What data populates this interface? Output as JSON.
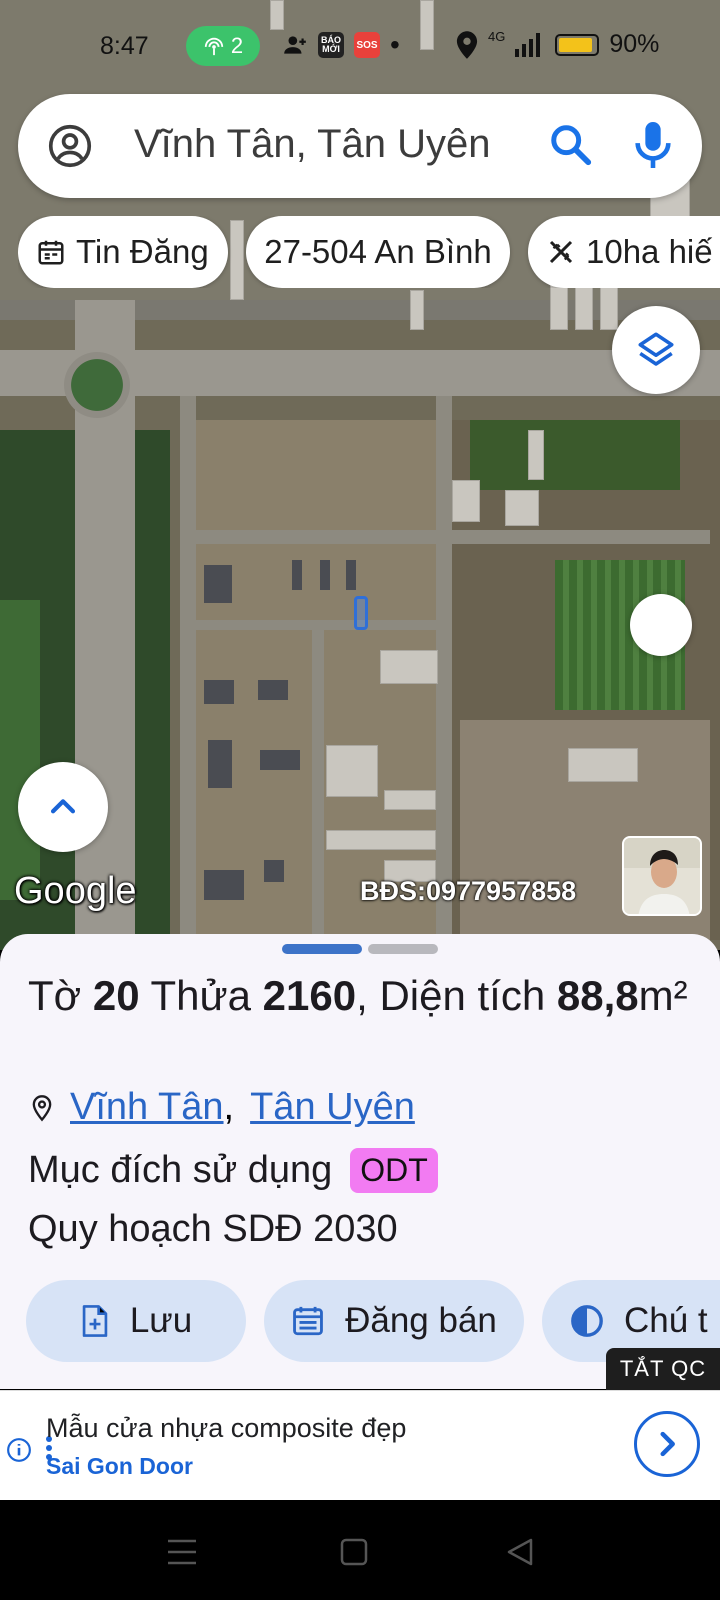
{
  "status_bar": {
    "time": "8:47",
    "hotspot_count": "2",
    "app_badge": "BÁO MỚI",
    "sos_badge": "SOS",
    "network": "4G",
    "battery_percent": "90%",
    "battery_level": 0.9
  },
  "search": {
    "text": "Vĩnh Tân, Tân Uyên",
    "icons": [
      "account-circle-icon",
      "search-icon",
      "mic-icon"
    ]
  },
  "chips": [
    {
      "label": "Tin Đăng",
      "icon": "calendar-icon"
    },
    {
      "label": "27-504 An Bình",
      "icon": ""
    },
    {
      "label": "10ha hiế",
      "icon": "ruler-cross-icon"
    }
  ],
  "map": {
    "attribution": "Google",
    "contact_text": "BĐS:0977957858"
  },
  "sheet": {
    "title_prefix": "Tờ ",
    "sheet_no": "20",
    "parcel_label": " Thửa ",
    "parcel_no": "2160",
    "area_label": ", Diện tích ",
    "area_value": "88,8",
    "area_unit": "m²",
    "location_commune": "Vĩnh Tân",
    "location_separator": ",",
    "location_town": "Tân Uyên",
    "purpose_label": "Mục đích sử dụng",
    "purpose_code": "ODT",
    "plan_label": "Quy hoạch SDĐ 2030",
    "actions": [
      {
        "label": "Lưu",
        "icon": "file-add-icon"
      },
      {
        "label": "Đăng bán",
        "icon": "calendar-list-icon"
      },
      {
        "label": "Chú t",
        "icon": "contrast-icon"
      }
    ],
    "ad_off_label": "TẮT QC"
  },
  "ad": {
    "title": "Mẫu cửa nhựa composite đẹp",
    "sponsor": "Sai Gon Door"
  },
  "colors": {
    "accent": "#2a66c6",
    "odt_badge": "#f27bf2",
    "action_bg": "#d7e3f6",
    "hotspot": "#3cc36b"
  }
}
